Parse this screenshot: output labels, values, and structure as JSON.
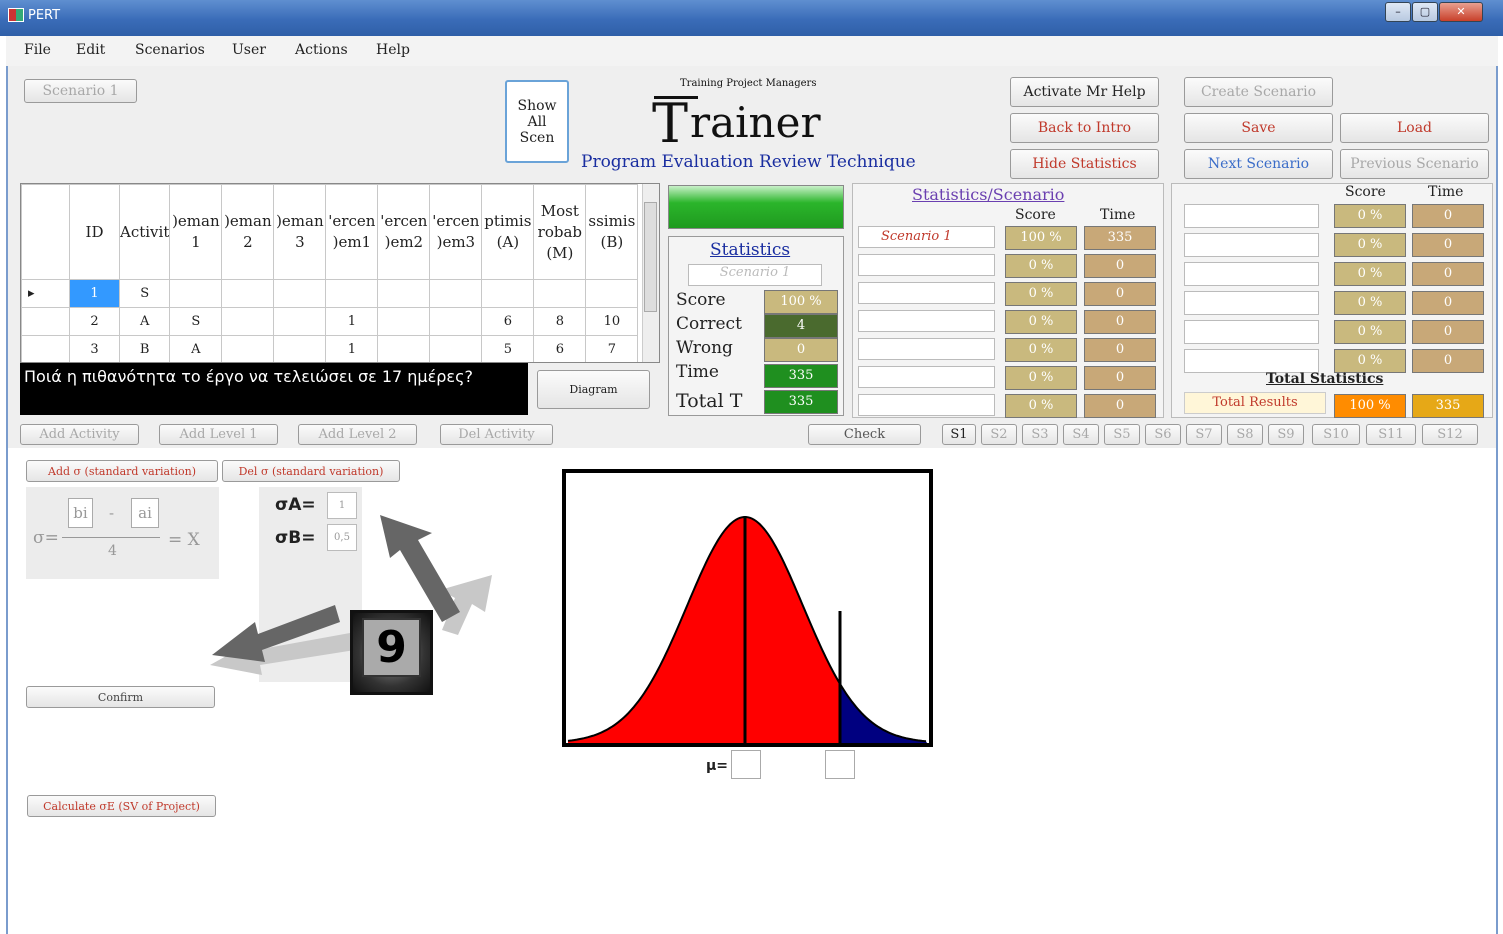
{
  "window": {
    "title": "PERT",
    "min": "–",
    "max": "▢",
    "close": "✕"
  },
  "menu": [
    "File",
    "Edit",
    "Scenarios",
    "User",
    "Actions",
    "Help"
  ],
  "top": {
    "scenario1": "Scenario 1",
    "show_all": [
      "Show",
      "All",
      "Scen"
    ],
    "training": "Training Project Managers",
    "trainer_T": "T",
    "trainer_rest": "rainer",
    "pert": "Program Evaluation Review Technique",
    "activate_help": "Activate Mr Help",
    "back_intro": "Back to Intro",
    "hide_stats": "Hide Statistics",
    "create_scenario": "Create Scenario",
    "save": "Save",
    "load": "Load",
    "next_scenario": "Next Scenario",
    "previous_scenario": "Previous Scenario"
  },
  "grid": {
    "headers": [
      [
        "ID"
      ],
      [
        "Activit"
      ],
      [
        ")eman",
        "1"
      ],
      [
        ")eman",
        "2"
      ],
      [
        ")eman",
        "3"
      ],
      [
        "'ercen",
        ")em1"
      ],
      [
        "'ercen",
        ")em2"
      ],
      [
        "'ercen",
        ")em3"
      ],
      [
        "ptimis",
        "(A)"
      ],
      [
        "Most",
        "robab",
        "(M)"
      ],
      [
        "ssimis",
        "(B)"
      ]
    ],
    "rows": [
      [
        "1",
        "S",
        "",
        "",
        "",
        "",
        "",
        "",
        "",
        "",
        ""
      ],
      [
        "2",
        "A",
        "S",
        "",
        "",
        "1",
        "",
        "",
        "6",
        "8",
        "10"
      ],
      [
        "3",
        "B",
        "A",
        "",
        "",
        "1",
        "",
        "",
        "5",
        "6",
        "7"
      ]
    ]
  },
  "question": "Ποιά η πιθανότητα το έργο να τελειώσει σε 17 ημέρες?",
  "diagram": "Diagram",
  "stats": {
    "title": "Statistics",
    "subtitle": "Scenario 1",
    "score_label": "Score",
    "score": "100 %",
    "correct_label": "Correct",
    "correct": "4",
    "wrong_label": "Wrong",
    "wrong": "0",
    "time_label": "Time",
    "time": "335",
    "total_label": "Total T",
    "total": "335"
  },
  "ss": {
    "title": "Statistics/Scenario",
    "score": "Score",
    "time": "Time",
    "rows": [
      {
        "name": "Scenario 1",
        "score": "100 %",
        "time": "335"
      },
      {
        "name": "",
        "score": "0 %",
        "time": "0"
      },
      {
        "name": "",
        "score": "0 %",
        "time": "0"
      },
      {
        "name": "",
        "score": "0 %",
        "time": "0"
      },
      {
        "name": "",
        "score": "0 %",
        "time": "0"
      },
      {
        "name": "",
        "score": "0 %",
        "time": "0"
      },
      {
        "name": "",
        "score": "0 %",
        "time": "0"
      }
    ]
  },
  "ts": {
    "score": "Score",
    "time": "Time",
    "rows": [
      {
        "score": "0 %",
        "time": "0"
      },
      {
        "score": "0 %",
        "time": "0"
      },
      {
        "score": "0 %",
        "time": "0"
      },
      {
        "score": "0 %",
        "time": "0"
      },
      {
        "score": "0 %",
        "time": "0"
      },
      {
        "score": "0 %",
        "time": "0"
      }
    ],
    "total_stats": "Total Statistics",
    "total_results": "Total Results",
    "total_score": "100 %",
    "total_time": "335"
  },
  "toolbar": {
    "add_activity": "Add Activity",
    "add_level1": "Add Level 1",
    "add_level2": "Add Level 2",
    "del_activity": "Del Activity",
    "check": "Check",
    "tabs": [
      "S1",
      "S2",
      "S3",
      "S4",
      "S5",
      "S6",
      "S7",
      "S8",
      "S9",
      "S10",
      "S11",
      "S12"
    ]
  },
  "lower": {
    "add_sigma": "Add σ (standard variation)",
    "del_sigma": "Del σ (standard variation)",
    "sigma": "σ=",
    "bi": "bi",
    "minus": "-",
    "ai": "ai",
    "four": "4",
    "eqx": "= X",
    "sa_label": "σA=",
    "sa_val": "1",
    "sb_label": "σB=",
    "sb_val": "0,5",
    "confirm": "Confirm",
    "calc": "Calculate σE (SV of Project)",
    "mu": "μ=",
    "badge": "9"
  },
  "colors": {
    "red": "#ff0000",
    "navy": "#000080",
    "green": "#1f8f1f"
  }
}
